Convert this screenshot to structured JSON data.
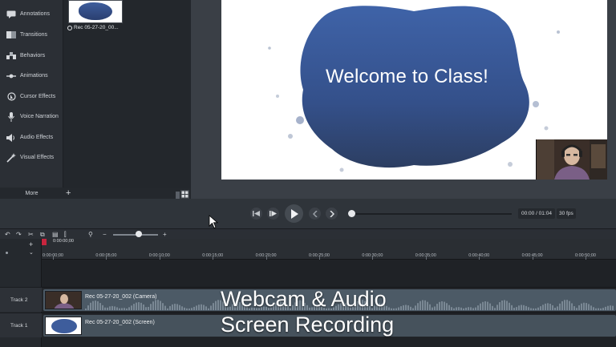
{
  "sidebar": {
    "items": [
      {
        "label": "Annotations",
        "icon": "annotation-icon"
      },
      {
        "label": "Transitions",
        "icon": "transition-icon"
      },
      {
        "label": "Behaviors",
        "icon": "behavior-icon"
      },
      {
        "label": "Animations",
        "icon": "animation-icon"
      },
      {
        "label": "Cursor Effects",
        "icon": "cursor-icon"
      },
      {
        "label": "Voice Narration",
        "icon": "microphone-icon"
      },
      {
        "label": "Audio Effects",
        "icon": "speaker-icon"
      },
      {
        "label": "Visual Effects",
        "icon": "visual-effects-icon"
      }
    ],
    "more_label": "More"
  },
  "media_bin": {
    "clip_name": "Rec 05-27-20_00..."
  },
  "canvas": {
    "slide_title": "Welcome to Class!"
  },
  "playback": {
    "time": "00:00 / 01:04",
    "fps": "30 fps",
    "progress": 0
  },
  "timeline": {
    "playhead_time": "0:00:00;00",
    "ruler_ticks": [
      "0:00:00;00",
      "0:00:05;00",
      "0:00:10;00",
      "0:00:15;00",
      "0:00:20;00",
      "0:00:25;00",
      "0:00:30;00",
      "0:00:35;00",
      "0:00:40;00",
      "0:00:45;00",
      "0:00:50;00"
    ],
    "tracks": [
      {
        "name": "Track 2",
        "clip_label": "Rec 05-27-20_002 (Camera)"
      },
      {
        "name": "Track 1",
        "clip_label": "Rec 05-27-20_002 (Screen)"
      }
    ]
  },
  "overlays": {
    "line1": "Webcam & Audio",
    "line2": "Screen Recording"
  },
  "colors": {
    "accent": "#c7253e",
    "clip": "#4c5a66",
    "slide_blue": "#3e5d9c"
  }
}
